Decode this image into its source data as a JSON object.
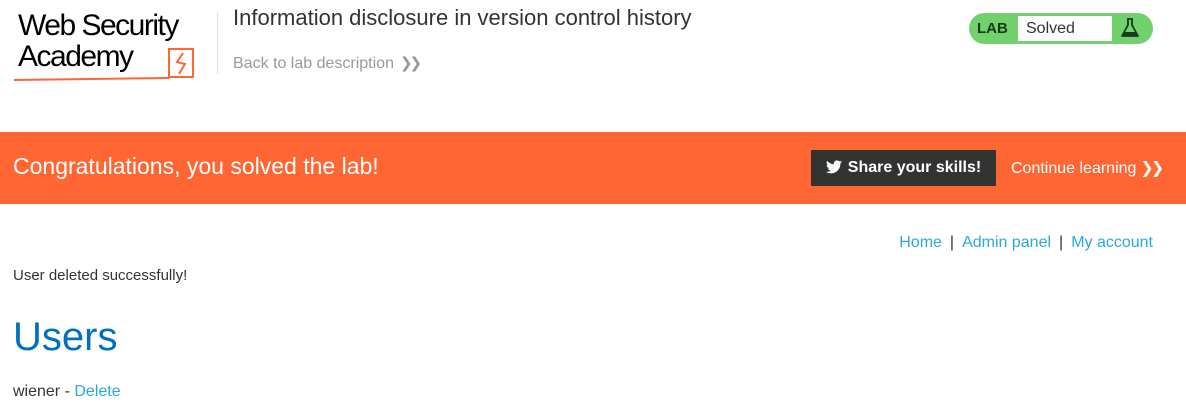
{
  "header": {
    "logo": {
      "line1": "Web Security",
      "line2": "Academy"
    },
    "lab_title": "Information disclosure in version control history",
    "back_link": "Back to lab description",
    "lab_status": {
      "label": "LAB",
      "status": "Solved"
    }
  },
  "banner": {
    "message": "Congratulations, you solved the lab!",
    "share_button": "Share your skills!",
    "continue_link": "Continue learning",
    "background_color": "#ff6633"
  },
  "nav": {
    "home": "Home",
    "admin_panel": "Admin panel",
    "my_account": "My account",
    "separator": "|"
  },
  "main": {
    "message": "User deleted successfully!",
    "heading": "Users",
    "users": [
      {
        "name": "wiener",
        "separator": "-",
        "action": "Delete"
      }
    ]
  },
  "icons": {
    "back_chevron": "double-chevron-right-icon",
    "continue_chevron": "double-chevron-right-icon",
    "share": "twitter-bird-icon",
    "lab_flask": "flask-icon"
  },
  "colors": {
    "accent_orange": "#ff6633",
    "link_blue": "#29a9e0",
    "heading_blue": "#0071bc",
    "lab_green": "#70d16d"
  }
}
